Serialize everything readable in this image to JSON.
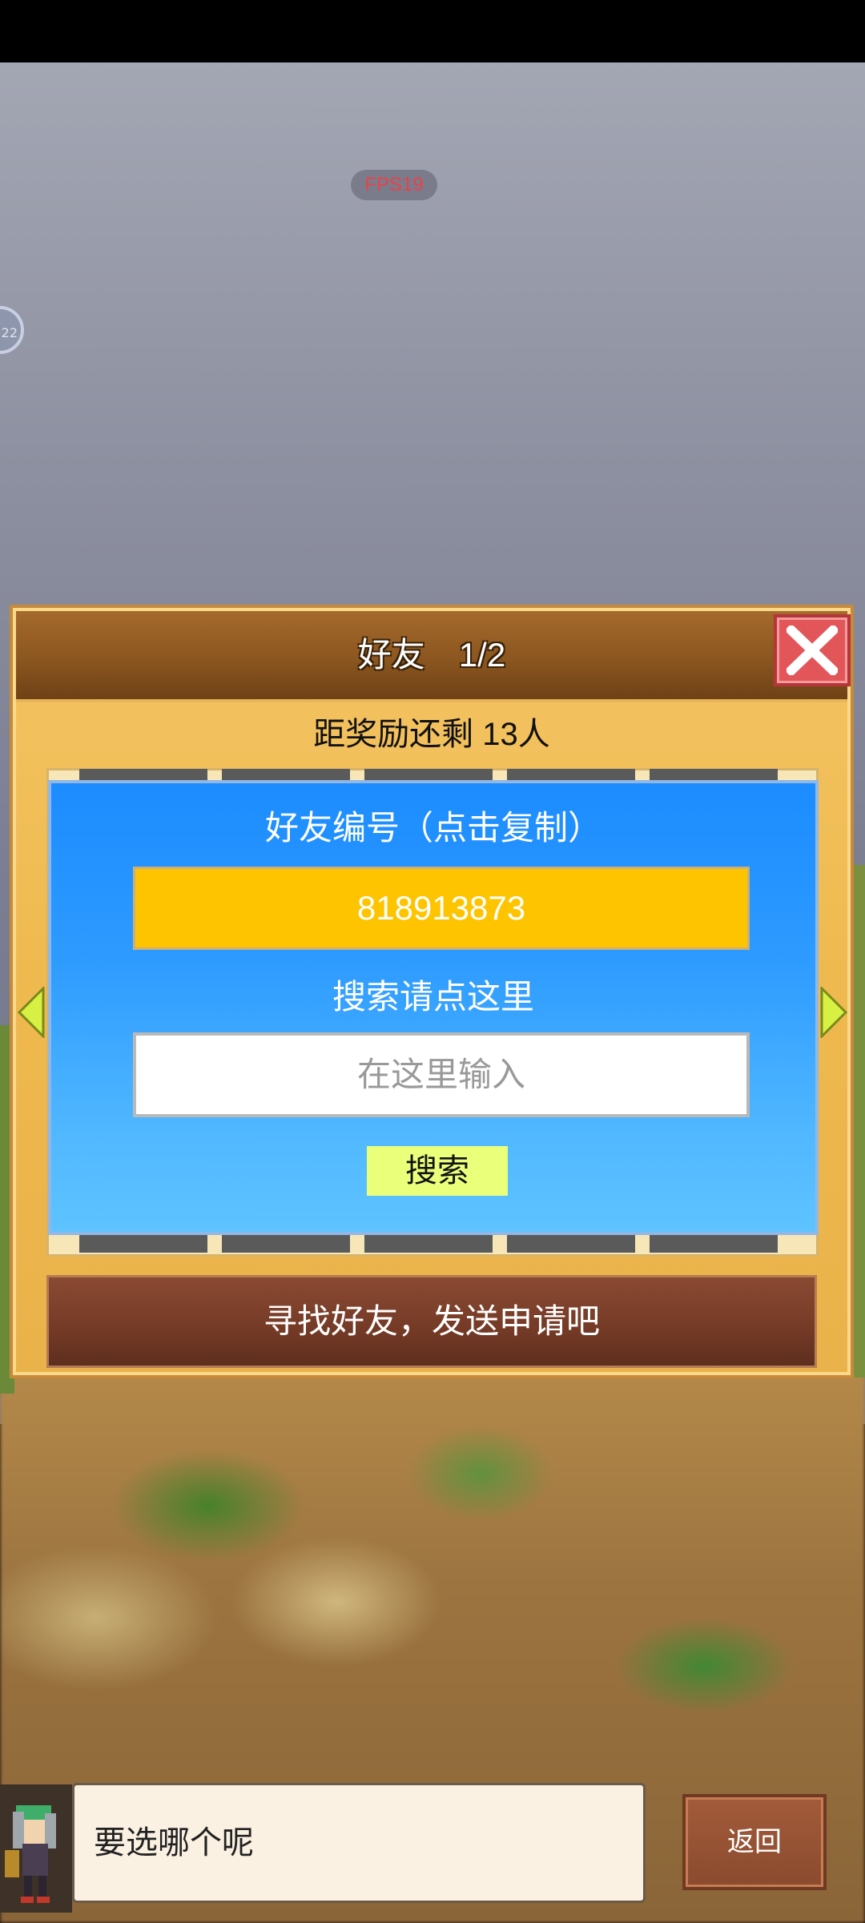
{
  "overlay": {
    "fps": "FPS19",
    "edge_badge": "22"
  },
  "dialog": {
    "title": "好友　1/2",
    "reward_text": "距奖励还剩 13人",
    "popup": {
      "id_label": "好友编号（点击复制）",
      "friend_id": "818913873",
      "search_label": "搜索请点这里",
      "search_placeholder": "在这里输入",
      "search_button": "搜索"
    },
    "find_button": "寻找好友，发送申请吧"
  },
  "bottom": {
    "speech": "要选哪个呢",
    "back_button": "返回"
  },
  "colors": {
    "header_brown": "#8b561f",
    "popup_blue": "#2e9bff",
    "id_yellow": "#ffc400",
    "search_button": "#eaff7a",
    "close_red": "#e2565a"
  }
}
